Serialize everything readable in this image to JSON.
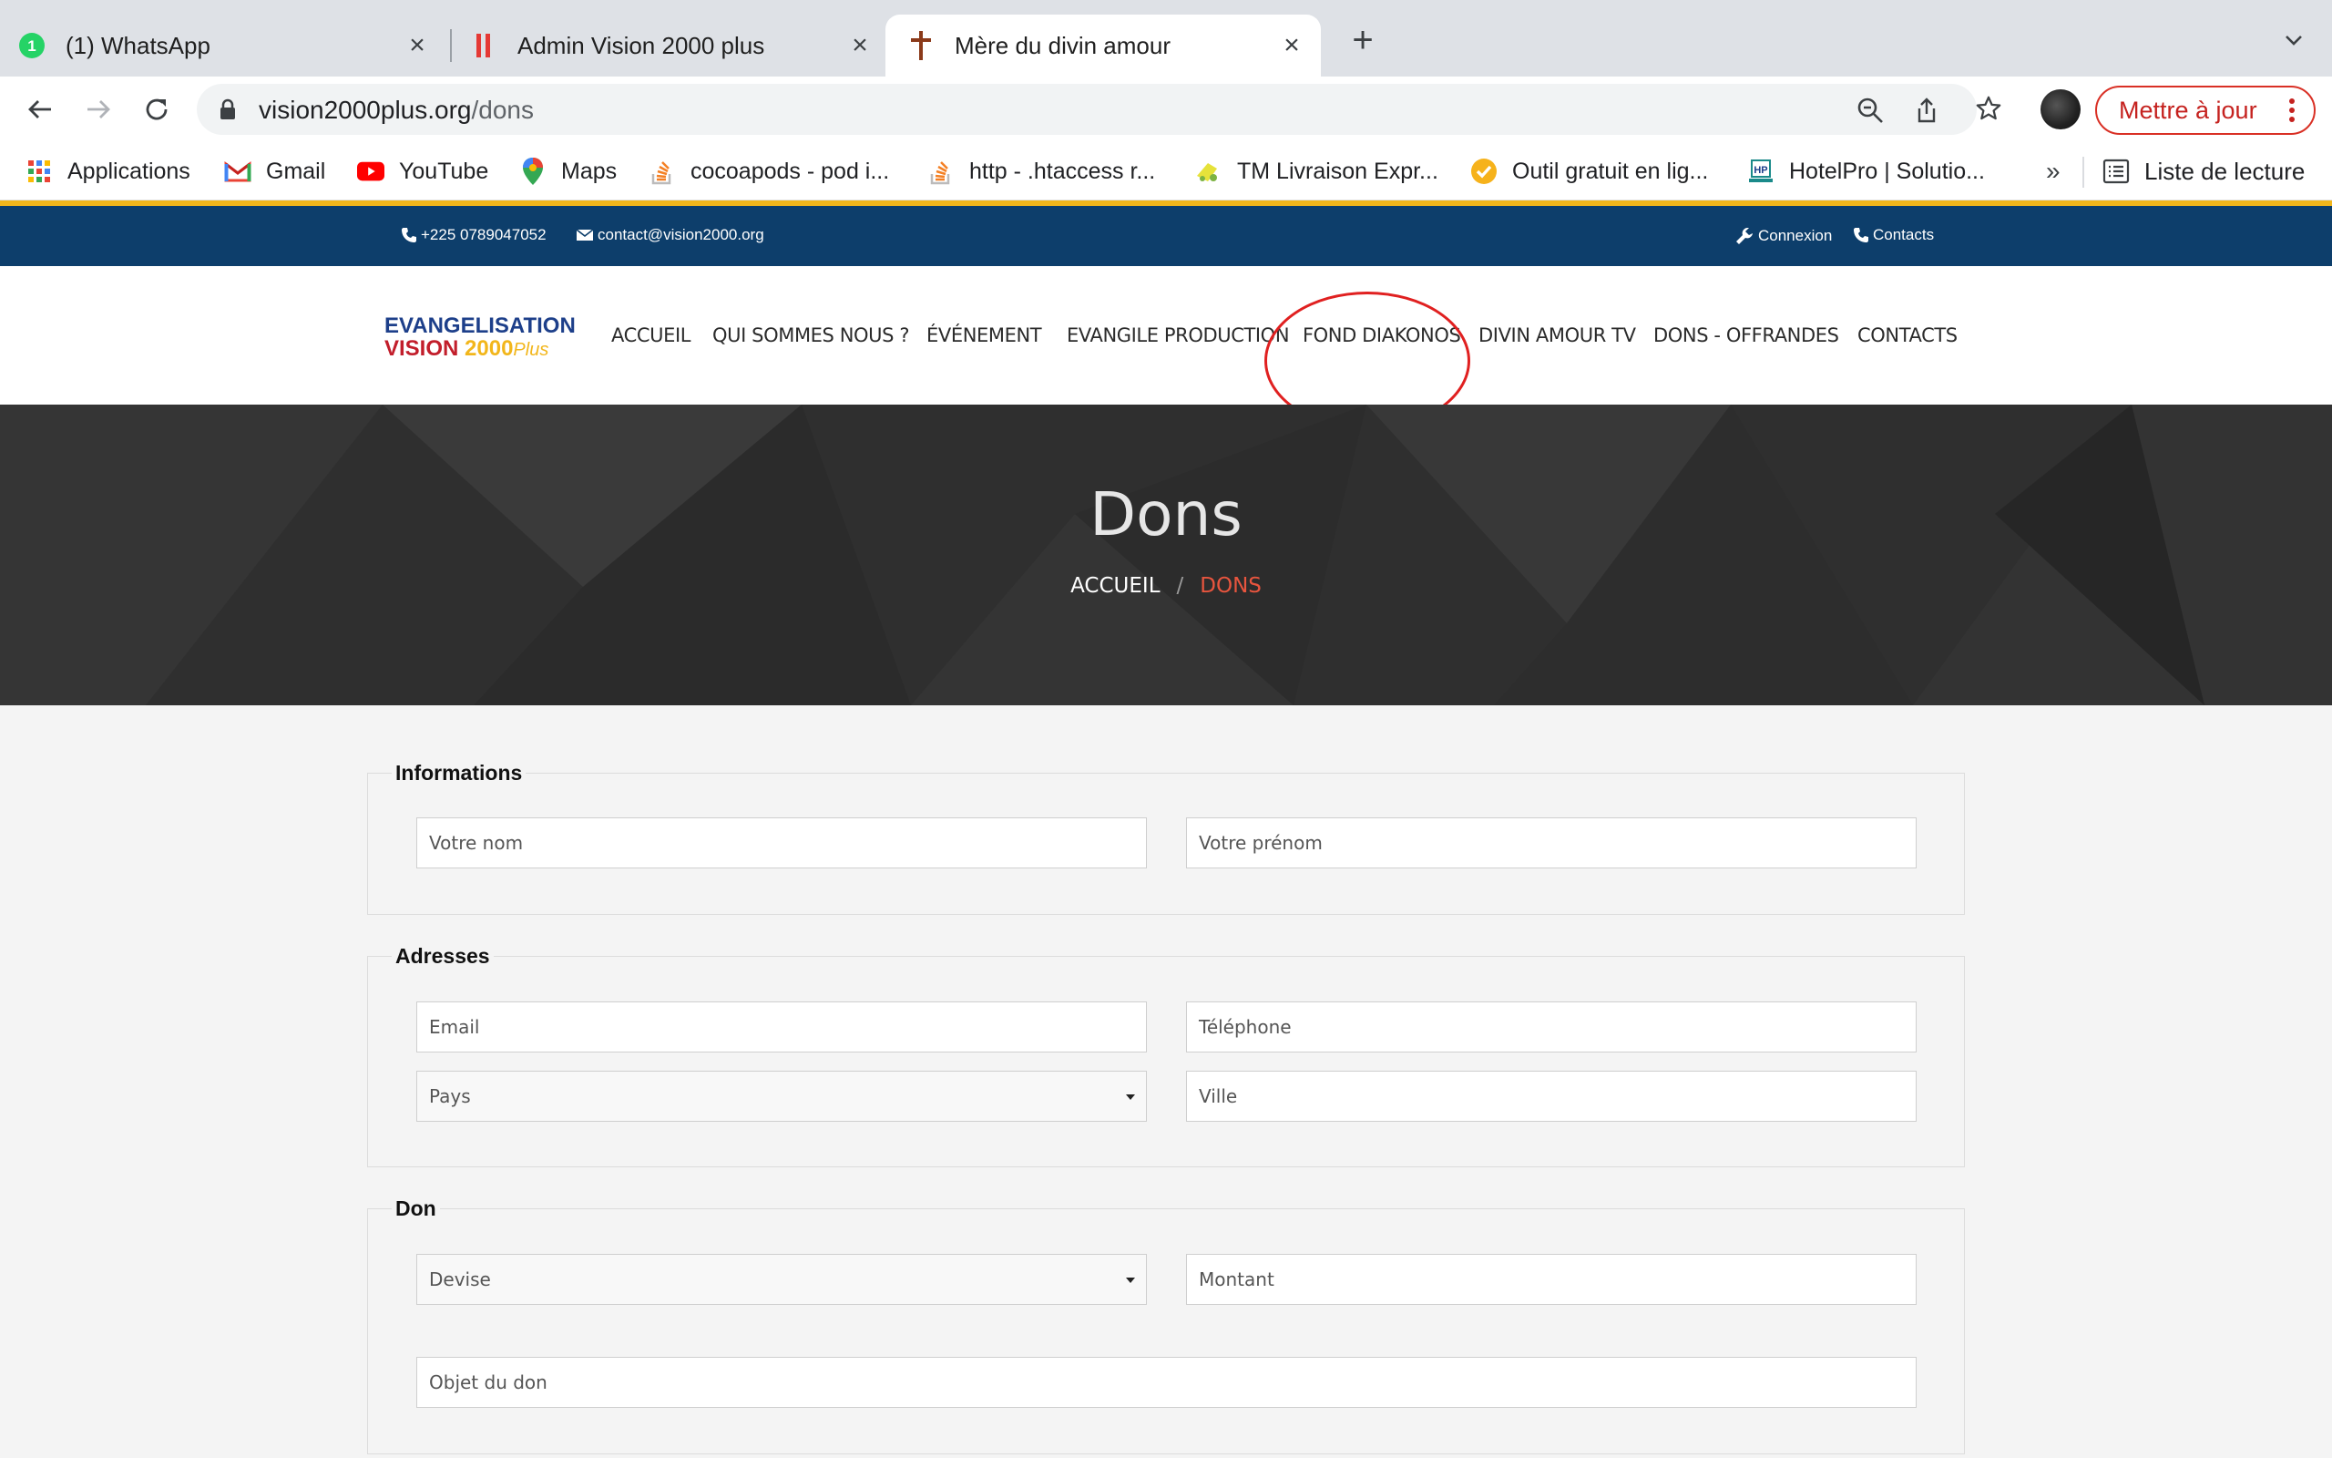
{
  "browser": {
    "tabs": [
      {
        "title": "(1) WhatsApp",
        "icon": "whatsapp-icon",
        "badge": "1"
      },
      {
        "title": "Admin Vision 2000 plus",
        "icon": "admin-icon"
      },
      {
        "title": "Mère du divin amour",
        "icon": "cross-icon",
        "active": true
      }
    ],
    "url_domain": "vision2000plus.org",
    "url_path": "/dons",
    "update_label": "Mettre à jour",
    "bookmarks": [
      {
        "label": "Applications",
        "icon": "apps-grid-icon"
      },
      {
        "label": "Gmail",
        "icon": "gmail-icon"
      },
      {
        "label": "YouTube",
        "icon": "youtube-icon"
      },
      {
        "label": "Maps",
        "icon": "maps-icon"
      },
      {
        "label": "cocoapods - pod i...",
        "icon": "stackoverflow-icon"
      },
      {
        "label": "http - .htaccess r...",
        "icon": "stackoverflow-icon"
      },
      {
        "label": "TM Livraison Expr...",
        "icon": "delivery-icon"
      },
      {
        "label": "Outil gratuit en lig...",
        "icon": "check-badge-icon"
      },
      {
        "label": "HotelPro | Solutio...",
        "icon": "hotelpro-icon"
      }
    ],
    "more_bookmarks": "»",
    "reading_list": "Liste de lecture"
  },
  "site": {
    "topbar": {
      "phone": "+225 0789047052",
      "email": "contact@vision2000.org",
      "login": "Connexion",
      "contacts": "Contacts"
    },
    "logo": {
      "line1": "EVANGELISATION",
      "line2": "VISION",
      "year": "2000",
      "plus": "Plus"
    },
    "menu": [
      "ACCUEIL",
      "QUI SOMMES NOUS ?",
      "ÉVÉNEMENT",
      "EVANGILE PRODUCTION",
      "FOND DIAKONOS",
      "DIVIN AMOUR TV",
      "DONS - OFFRANDES",
      "CONTACTS"
    ],
    "hero": {
      "title": "Dons",
      "breadcrumb_home": "ACCUEIL",
      "breadcrumb_sep": "/",
      "breadcrumb_current": "DONS"
    },
    "form": {
      "informations": {
        "legend": "Informations",
        "nom": "Votre nom",
        "prenom": "Votre prénom"
      },
      "adresses": {
        "legend": "Adresses",
        "email": "Email",
        "telephone": "Téléphone",
        "pays": "Pays",
        "ville": "Ville"
      },
      "don": {
        "legend": "Don",
        "devise": "Devise",
        "montant": "Montant",
        "objet": "Objet du don"
      }
    }
  },
  "colors": {
    "topbar": "#0d3e6b",
    "accent": "#e8553e",
    "annotation": "#e02020"
  }
}
